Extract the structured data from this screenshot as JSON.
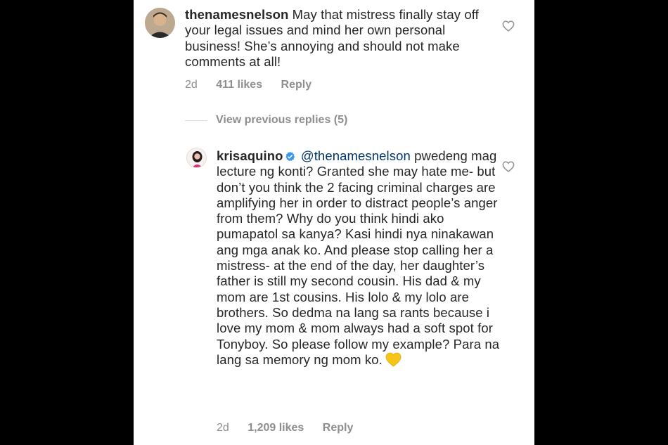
{
  "comments": [
    {
      "username": "thenamesnelson",
      "text": "May that mistress finally stay off your legal issues and mind her own personal business! She’s annoying and should not make comments at all!",
      "time": "2d",
      "likes": "411 likes",
      "reply_label": "Reply"
    },
    {
      "username": "krisaquino",
      "verified": true,
      "mention": "@thenamesnelson",
      "text": "pwedeng mag lecture ng konti? Granted she may hate me- but don’t you think the 2 facing criminal charges are amplifying her in order to distract people’s anger from them?  Why do you think hindi ako pumapatol sa kanya? Kasi hindi nya ninakawan ang mga anak ko. And please stop calling her a mistress- at the end of the day, her daughter’s father is still my second cousin. His dad & my mom are 1st cousins. His lolo & my lolo are brothers. So dedma na lang sa rants because i love my mom & mom always had a soft spot for Tonyboy. So please follow my example? Para na lang sa memory ng mom ko.",
      "emoji": "yellow-heart",
      "time": "2d",
      "likes": "1,209 likes",
      "reply_label": "Reply"
    }
  ],
  "view_previous": "View previous replies (5)",
  "colors": {
    "verified": "#3897f0",
    "mention": "#003569",
    "meta": "#8e8e8e",
    "emoji_heart": "#f5c518"
  }
}
